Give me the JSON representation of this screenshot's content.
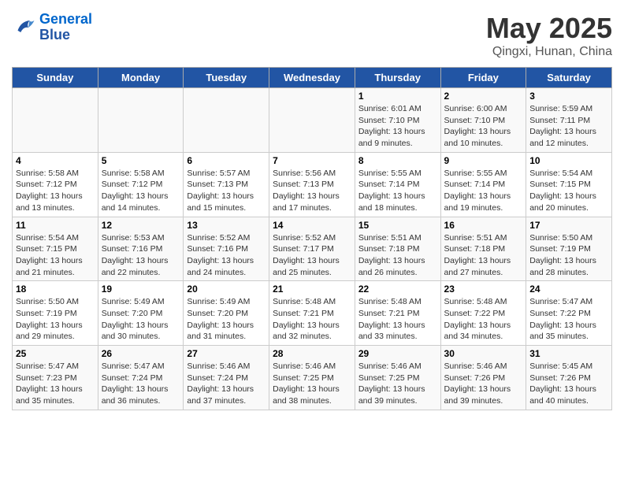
{
  "header": {
    "logo_line1": "General",
    "logo_line2": "Blue",
    "month": "May 2025",
    "location": "Qingxi, Hunan, China"
  },
  "weekdays": [
    "Sunday",
    "Monday",
    "Tuesday",
    "Wednesday",
    "Thursday",
    "Friday",
    "Saturday"
  ],
  "weeks": [
    [
      {
        "day": "",
        "info": ""
      },
      {
        "day": "",
        "info": ""
      },
      {
        "day": "",
        "info": ""
      },
      {
        "day": "",
        "info": ""
      },
      {
        "day": "1",
        "info": "Sunrise: 6:01 AM\nSunset: 7:10 PM\nDaylight: 13 hours\nand 9 minutes."
      },
      {
        "day": "2",
        "info": "Sunrise: 6:00 AM\nSunset: 7:10 PM\nDaylight: 13 hours\nand 10 minutes."
      },
      {
        "day": "3",
        "info": "Sunrise: 5:59 AM\nSunset: 7:11 PM\nDaylight: 13 hours\nand 12 minutes."
      }
    ],
    [
      {
        "day": "4",
        "info": "Sunrise: 5:58 AM\nSunset: 7:12 PM\nDaylight: 13 hours\nand 13 minutes."
      },
      {
        "day": "5",
        "info": "Sunrise: 5:58 AM\nSunset: 7:12 PM\nDaylight: 13 hours\nand 14 minutes."
      },
      {
        "day": "6",
        "info": "Sunrise: 5:57 AM\nSunset: 7:13 PM\nDaylight: 13 hours\nand 15 minutes."
      },
      {
        "day": "7",
        "info": "Sunrise: 5:56 AM\nSunset: 7:13 PM\nDaylight: 13 hours\nand 17 minutes."
      },
      {
        "day": "8",
        "info": "Sunrise: 5:55 AM\nSunset: 7:14 PM\nDaylight: 13 hours\nand 18 minutes."
      },
      {
        "day": "9",
        "info": "Sunrise: 5:55 AM\nSunset: 7:14 PM\nDaylight: 13 hours\nand 19 minutes."
      },
      {
        "day": "10",
        "info": "Sunrise: 5:54 AM\nSunset: 7:15 PM\nDaylight: 13 hours\nand 20 minutes."
      }
    ],
    [
      {
        "day": "11",
        "info": "Sunrise: 5:54 AM\nSunset: 7:15 PM\nDaylight: 13 hours\nand 21 minutes."
      },
      {
        "day": "12",
        "info": "Sunrise: 5:53 AM\nSunset: 7:16 PM\nDaylight: 13 hours\nand 22 minutes."
      },
      {
        "day": "13",
        "info": "Sunrise: 5:52 AM\nSunset: 7:16 PM\nDaylight: 13 hours\nand 24 minutes."
      },
      {
        "day": "14",
        "info": "Sunrise: 5:52 AM\nSunset: 7:17 PM\nDaylight: 13 hours\nand 25 minutes."
      },
      {
        "day": "15",
        "info": "Sunrise: 5:51 AM\nSunset: 7:18 PM\nDaylight: 13 hours\nand 26 minutes."
      },
      {
        "day": "16",
        "info": "Sunrise: 5:51 AM\nSunset: 7:18 PM\nDaylight: 13 hours\nand 27 minutes."
      },
      {
        "day": "17",
        "info": "Sunrise: 5:50 AM\nSunset: 7:19 PM\nDaylight: 13 hours\nand 28 minutes."
      }
    ],
    [
      {
        "day": "18",
        "info": "Sunrise: 5:50 AM\nSunset: 7:19 PM\nDaylight: 13 hours\nand 29 minutes."
      },
      {
        "day": "19",
        "info": "Sunrise: 5:49 AM\nSunset: 7:20 PM\nDaylight: 13 hours\nand 30 minutes."
      },
      {
        "day": "20",
        "info": "Sunrise: 5:49 AM\nSunset: 7:20 PM\nDaylight: 13 hours\nand 31 minutes."
      },
      {
        "day": "21",
        "info": "Sunrise: 5:48 AM\nSunset: 7:21 PM\nDaylight: 13 hours\nand 32 minutes."
      },
      {
        "day": "22",
        "info": "Sunrise: 5:48 AM\nSunset: 7:21 PM\nDaylight: 13 hours\nand 33 minutes."
      },
      {
        "day": "23",
        "info": "Sunrise: 5:48 AM\nSunset: 7:22 PM\nDaylight: 13 hours\nand 34 minutes."
      },
      {
        "day": "24",
        "info": "Sunrise: 5:47 AM\nSunset: 7:22 PM\nDaylight: 13 hours\nand 35 minutes."
      }
    ],
    [
      {
        "day": "25",
        "info": "Sunrise: 5:47 AM\nSunset: 7:23 PM\nDaylight: 13 hours\nand 35 minutes."
      },
      {
        "day": "26",
        "info": "Sunrise: 5:47 AM\nSunset: 7:24 PM\nDaylight: 13 hours\nand 36 minutes."
      },
      {
        "day": "27",
        "info": "Sunrise: 5:46 AM\nSunset: 7:24 PM\nDaylight: 13 hours\nand 37 minutes."
      },
      {
        "day": "28",
        "info": "Sunrise: 5:46 AM\nSunset: 7:25 PM\nDaylight: 13 hours\nand 38 minutes."
      },
      {
        "day": "29",
        "info": "Sunrise: 5:46 AM\nSunset: 7:25 PM\nDaylight: 13 hours\nand 39 minutes."
      },
      {
        "day": "30",
        "info": "Sunrise: 5:46 AM\nSunset: 7:26 PM\nDaylight: 13 hours\nand 39 minutes."
      },
      {
        "day": "31",
        "info": "Sunrise: 5:45 AM\nSunset: 7:26 PM\nDaylight: 13 hours\nand 40 minutes."
      }
    ]
  ]
}
